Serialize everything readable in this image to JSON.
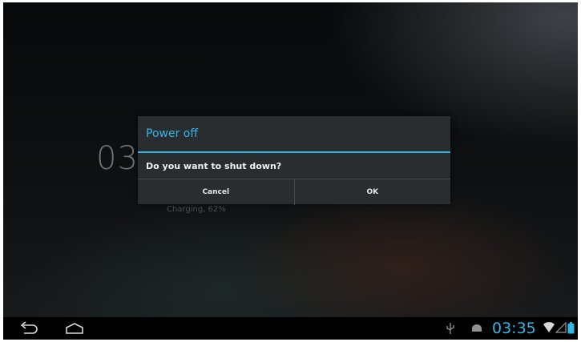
{
  "lockscreen": {
    "clock_partial": "03",
    "charging_text": "Charging, 62%"
  },
  "dialog": {
    "title": "Power off",
    "message": "Do you want to shut down?",
    "cancel_label": "Cancel",
    "ok_label": "OK"
  },
  "navbar": {
    "back_icon": "back-arrow-icon",
    "home_icon": "home-icon"
  },
  "statusbar": {
    "time": "03:35",
    "icons": [
      "usb-icon",
      "android-debug-icon",
      "wifi-icon",
      "signal-icon",
      "battery-icon"
    ]
  },
  "colors": {
    "accent": "#33b5e5",
    "dialog_bg": "#2a2d30"
  }
}
